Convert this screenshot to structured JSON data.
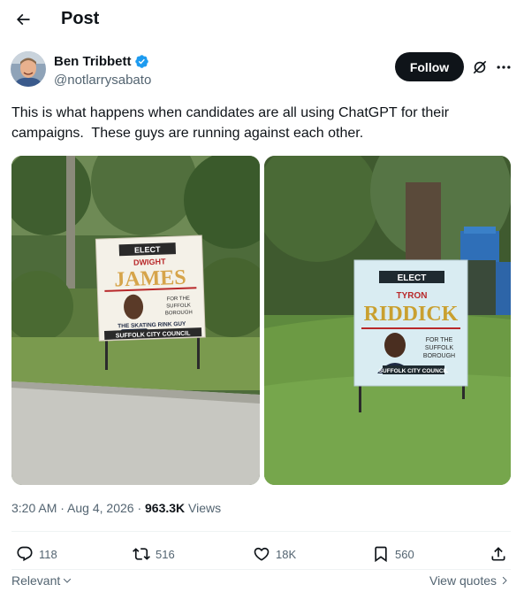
{
  "header": {
    "title": "Post",
    "back_icon": "arrow-left-icon"
  },
  "author": {
    "name": "Ben Tribbett",
    "handle": "@notlarrysabato",
    "verified": true,
    "verified_color": "#1d9bf0"
  },
  "actions_top": {
    "follow_label": "Follow",
    "grok_icon": "grok-icon",
    "more_icon": "more-icon"
  },
  "tweet": {
    "text": "This is what happens when candidates are all using ChatGPT for their campaigns.  These guys are running against each other."
  },
  "photos": [
    {
      "sign": {
        "elect": "ELECT",
        "first_name": "DWIGHT",
        "last_name": "JAMES",
        "line1": "FOR THE",
        "line2": "SUFFOLK",
        "line3": "BOROUGH",
        "tagline": "THE SKATING RINK GUY",
        "council": "SUFFOLK CITY COUNCIL"
      }
    },
    {
      "sign": {
        "elect": "ELECT",
        "first_name": "TYRON",
        "last_name": "RIDDICK",
        "line1": "FOR THE",
        "line2": "SUFFOLK",
        "line3": "BOROUGH",
        "council": "SUFFOLK CITY COUNCIL"
      }
    }
  ],
  "meta": {
    "time": "3:20 AM",
    "sep1": " · ",
    "date": "Aug 4, 2026",
    "sep2": " · ",
    "views_count": "963.3K",
    "views_label": " Views"
  },
  "engagement": {
    "replies": "118",
    "reposts": "516",
    "likes": "18K",
    "bookmarks": "560"
  },
  "footer": {
    "sort_label": "Relevant",
    "view_quotes_label": "View quotes"
  },
  "colors": {
    "text": "#0f1419",
    "secondary": "#536471",
    "divider": "#eff3f4",
    "accent": "#1d9bf0"
  }
}
